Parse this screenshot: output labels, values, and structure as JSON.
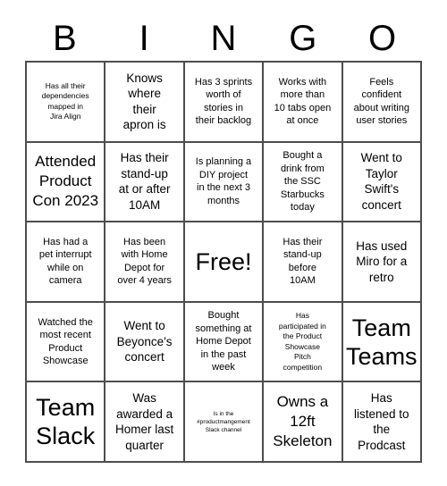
{
  "header": {
    "letters": [
      "B",
      "I",
      "N",
      "G",
      "O"
    ]
  },
  "grid": {
    "rows": 5,
    "columns": 5,
    "cells": [
      {
        "text": "Has all their\ndependencies\nmapped in\nJira Align",
        "size": "sm",
        "free": false
      },
      {
        "text": "Knows\nwhere\ntheir\napron is",
        "size": "lg",
        "free": false
      },
      {
        "text": "Has 3 sprints\nworth of\nstories in\ntheir backlog",
        "size": "md",
        "free": false
      },
      {
        "text": "Works with\nmore than\n10 tabs open\nat once",
        "size": "md",
        "free": false
      },
      {
        "text": "Feels\nconfident\nabout writing\nuser stories",
        "size": "md",
        "free": false
      },
      {
        "text": "Attended\nProduct\nCon 2023",
        "size": "xl",
        "free": false
      },
      {
        "text": "Has their\nstand-up\nat or after\n10AM",
        "size": "lg",
        "free": false
      },
      {
        "text": "Is planning a\nDIY project\nin the next 3\nmonths",
        "size": "md",
        "free": false
      },
      {
        "text": "Bought a\ndrink from\nthe SSC\nStarbucks\ntoday",
        "size": "md",
        "free": false
      },
      {
        "text": "Went to\nTaylor\nSwift's\nconcert",
        "size": "lg",
        "free": false
      },
      {
        "text": "Has had a\npet interrupt\nwhile on\ncamera",
        "size": "md",
        "free": false
      },
      {
        "text": "Has been\nwith Home\nDepot for\nover 4 years",
        "size": "md",
        "free": false
      },
      {
        "text": "Free!",
        "size": "xxl",
        "free": true
      },
      {
        "text": "Has their\nstand-up\nbefore\n10AM",
        "size": "md",
        "free": false
      },
      {
        "text": "Has used\nMiro for a\nretro",
        "size": "lg",
        "free": false
      },
      {
        "text": "Watched the\nmost recent\nProduct\nShowcase",
        "size": "md",
        "free": false
      },
      {
        "text": "Went to\nBeyonce's\nconcert",
        "size": "lg",
        "free": false
      },
      {
        "text": "Bought\nsomething at\nHome Depot\nin the past\nweek",
        "size": "md",
        "free": false
      },
      {
        "text": "Has\nparticipated in\nthe Product\nShowcase\nPitch\ncompetition",
        "size": "sm",
        "free": false
      },
      {
        "text": "Team\nTeams",
        "size": "xxl",
        "free": false
      },
      {
        "text": "Team\nSlack",
        "size": "xxl",
        "free": false
      },
      {
        "text": "Was\nawarded a\nHomer last\nquarter",
        "size": "lg",
        "free": false
      },
      {
        "text": "Is in the\n#productmangement\nSlack channel",
        "size": "xs",
        "free": false
      },
      {
        "text": "Owns a\n12ft\nSkeleton",
        "size": "xl",
        "free": false
      },
      {
        "text": "Has\nlistened to\nthe\nProdcast",
        "size": "lg",
        "free": false
      }
    ]
  }
}
